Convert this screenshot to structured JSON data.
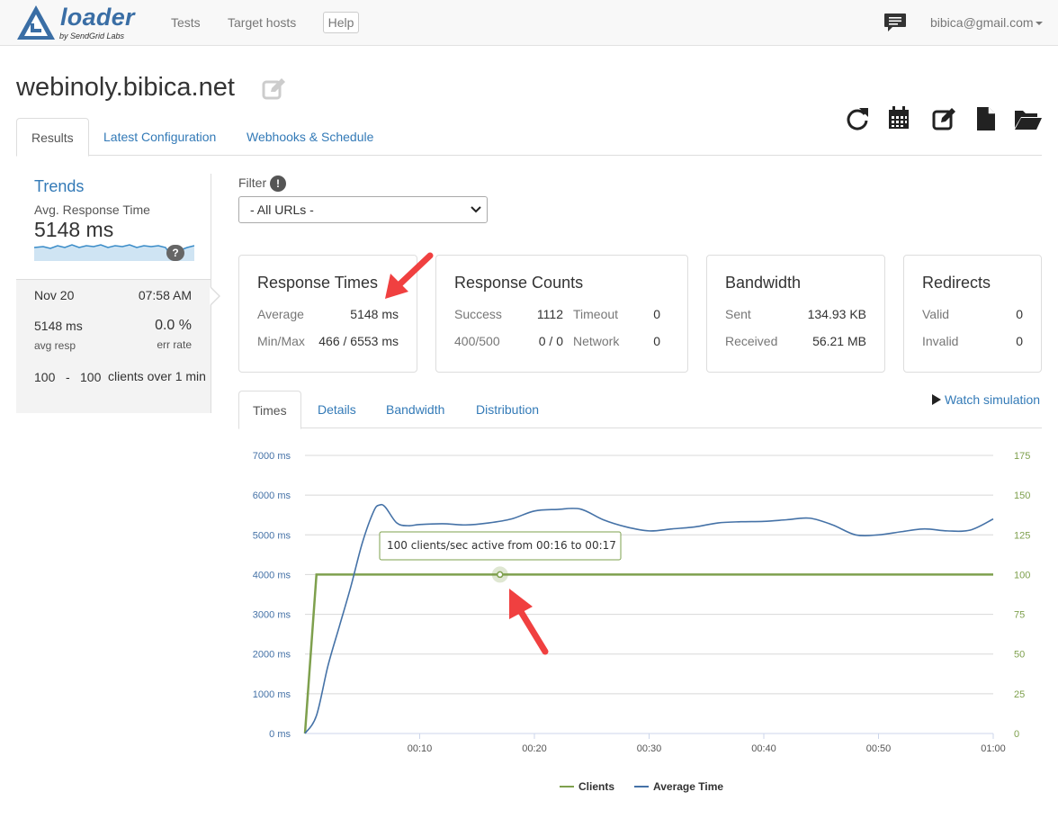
{
  "navbar": {
    "logo_word": "loader",
    "logo_sub": "by SendGrid Labs",
    "tests": "Tests",
    "target_hosts": "Target hosts",
    "help": "Help",
    "user": "bibica@gmail.com"
  },
  "page_title": "webinoly.bibica.net",
  "main_tabs": [
    {
      "label": "Results"
    },
    {
      "label": "Latest Configuration"
    },
    {
      "label": "Webhooks & Schedule"
    }
  ],
  "sidebar": {
    "trends_title": "Trends",
    "trend_label": "Avg. Response Time",
    "trend_value": "5148 ms",
    "help_badge": "?",
    "run": {
      "date": "Nov 20",
      "time": "07:58 AM",
      "avg_resp": "5148 ms",
      "avg_resp_label": "avg resp",
      "err_rate": "0.0 %",
      "err_rate_label": "err rate",
      "clients_from": "100",
      "dash": "-",
      "clients_to": "100",
      "clients_desc": "clients over 1 min"
    }
  },
  "filter": {
    "label": "Filter",
    "info": "!",
    "selected": "- All URLs -"
  },
  "cards": {
    "response_times": {
      "title": "Response Times",
      "average_label": "Average",
      "average": "5148 ms",
      "minmax_label": "Min/Max",
      "minmax": "466 / 6553 ms"
    },
    "response_counts": {
      "title": "Response Counts",
      "success_label": "Success",
      "success": "1112",
      "timeout_label": "Timeout",
      "timeout": "0",
      "err_label": "400/500",
      "err": "0 / 0",
      "network_label": "Network",
      "network": "0"
    },
    "bandwidth": {
      "title": "Bandwidth",
      "sent_label": "Sent",
      "sent": "134.93 KB",
      "received_label": "Received",
      "received": "56.21 MB"
    },
    "redirects": {
      "title": "Redirects",
      "valid_label": "Valid",
      "valid": "0",
      "invalid_label": "Invalid",
      "invalid": "0"
    }
  },
  "chart_tabs": [
    {
      "label": "Times"
    },
    {
      "label": "Details"
    },
    {
      "label": "Bandwidth"
    },
    {
      "label": "Distribution"
    }
  ],
  "watch_simulation": "Watch simulation",
  "colors": {
    "clients": "#7ea04d",
    "average_time": "#4572a7",
    "link": "#337ab7",
    "annotation_arrow": "#f04040"
  },
  "chart_data": {
    "type": "line",
    "x_ticks": [
      "00:10",
      "00:20",
      "00:30",
      "00:40",
      "00:50",
      "01:00"
    ],
    "y_left_ticks": [
      "0 ms",
      "1000 ms",
      "2000 ms",
      "3000 ms",
      "4000 ms",
      "5000 ms",
      "6000 ms",
      "7000 ms"
    ],
    "y_right_ticks": [
      "0",
      "25",
      "50",
      "75",
      "100",
      "125",
      "150",
      "175"
    ],
    "ylim_left": [
      0,
      7000
    ],
    "ylim_right": [
      0,
      175
    ],
    "xlim": [
      0,
      60
    ],
    "grid": true,
    "legend_position": "bottom-center",
    "tooltip": "100 clients/sec active from 00:16 to 00:17",
    "series": [
      {
        "name": "Clients",
        "axis": "right",
        "x": [
          0,
          1,
          2,
          10,
          17,
          30,
          40,
          50,
          60
        ],
        "values": [
          0,
          100,
          100,
          100,
          100,
          100,
          100,
          100,
          100
        ]
      },
      {
        "name": "Average Time",
        "axis": "left",
        "x": [
          0,
          1,
          2,
          3,
          4,
          5,
          6,
          6.5,
          7,
          8,
          9,
          10,
          12,
          14,
          16,
          18,
          20,
          22,
          24,
          26,
          28,
          30,
          32,
          34,
          36,
          38,
          40,
          42,
          44,
          46,
          48,
          50,
          52,
          54,
          56,
          58,
          60
        ],
        "values": [
          0,
          450,
          1700,
          2700,
          3700,
          4800,
          5600,
          5750,
          5700,
          5300,
          5230,
          5260,
          5280,
          5250,
          5300,
          5400,
          5600,
          5640,
          5650,
          5380,
          5200,
          5100,
          5150,
          5200,
          5300,
          5330,
          5340,
          5380,
          5420,
          5250,
          5000,
          5000,
          5080,
          5150,
          5100,
          5120,
          5400
        ]
      }
    ]
  }
}
